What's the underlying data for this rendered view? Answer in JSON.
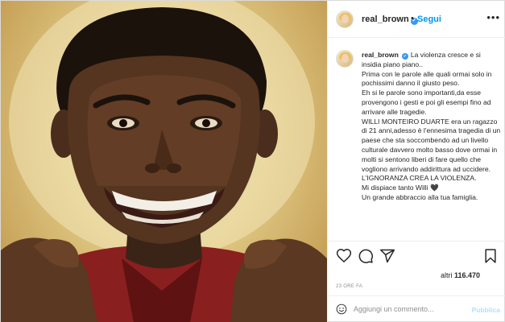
{
  "post": {
    "username": "real_brown",
    "verified": true,
    "separator": "•",
    "follow_label": "Segui",
    "more_icon": "more-horizontal-icon",
    "caption_text": "La violenza cresce e si insidia piano piano..\nPrima con le parole alle quali ormai solo in pochissimi danno il giusto peso.\nEh si le parole sono importanti,da esse provengono i gesti e poi gli esempi fino ad arrivare alle tragedie.\nWILLI MONTEIRO DUARTE era un ragazzo di 21 anni,adesso è l'ennesima tragedia di un paese che sta soccombendo ad un livello culturale davvero molto basso dove ormai in molti si sentono liberi di fare quello che vogliono arrivando addirittura ad uccidere.\nL'IGNORANZA CREA LA VIOLENZA.\nMi dispiace tanto Willi 🖤\nUn grande abbraccio alla tua famiglia.",
    "likes_prefix": "altri",
    "likes_count": "116.470",
    "timestamp": "23 ORE FA"
  },
  "comment": {
    "placeholder": "Aggiungi un commento...",
    "publish_label": "Pubblica"
  },
  "icons": {
    "like": "heart-icon",
    "comment": "comment-icon",
    "share": "share-icon",
    "save": "bookmark-icon",
    "emoji": "emoji-icon"
  },
  "colors": {
    "accent": "#0095f6",
    "verified": "#3897f0",
    "publish_disabled": "#b2dffc",
    "muted_text": "#8e8e8e"
  }
}
